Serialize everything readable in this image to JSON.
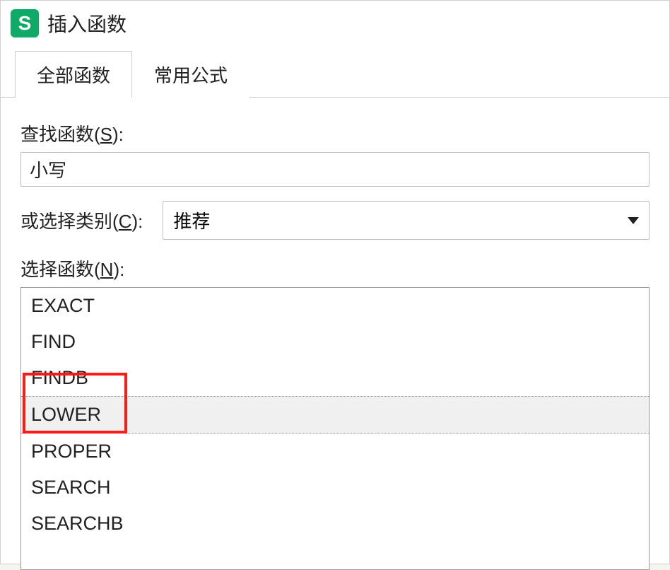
{
  "window": {
    "title": "插入函数",
    "icon_letter": "S"
  },
  "tabs": [
    {
      "label": "全部函数",
      "active": true
    },
    {
      "label": "常用公式",
      "active": false
    }
  ],
  "search": {
    "label_prefix": "查找函数(",
    "label_hotkey": "S",
    "label_suffix": "):",
    "value": "小写"
  },
  "category": {
    "label_prefix": "或选择类别(",
    "label_hotkey": "C",
    "label_suffix": "):",
    "selected": "推荐"
  },
  "functions": {
    "label_prefix": "选择函数(",
    "label_hotkey": "N",
    "label_suffix": "):",
    "items": [
      {
        "name": "EXACT",
        "selected": false
      },
      {
        "name": "FIND",
        "selected": false
      },
      {
        "name": "FINDB",
        "selected": false
      },
      {
        "name": "LOWER",
        "selected": true
      },
      {
        "name": "PROPER",
        "selected": false
      },
      {
        "name": "SEARCH",
        "selected": false
      },
      {
        "name": "SEARCHB",
        "selected": false
      }
    ]
  }
}
